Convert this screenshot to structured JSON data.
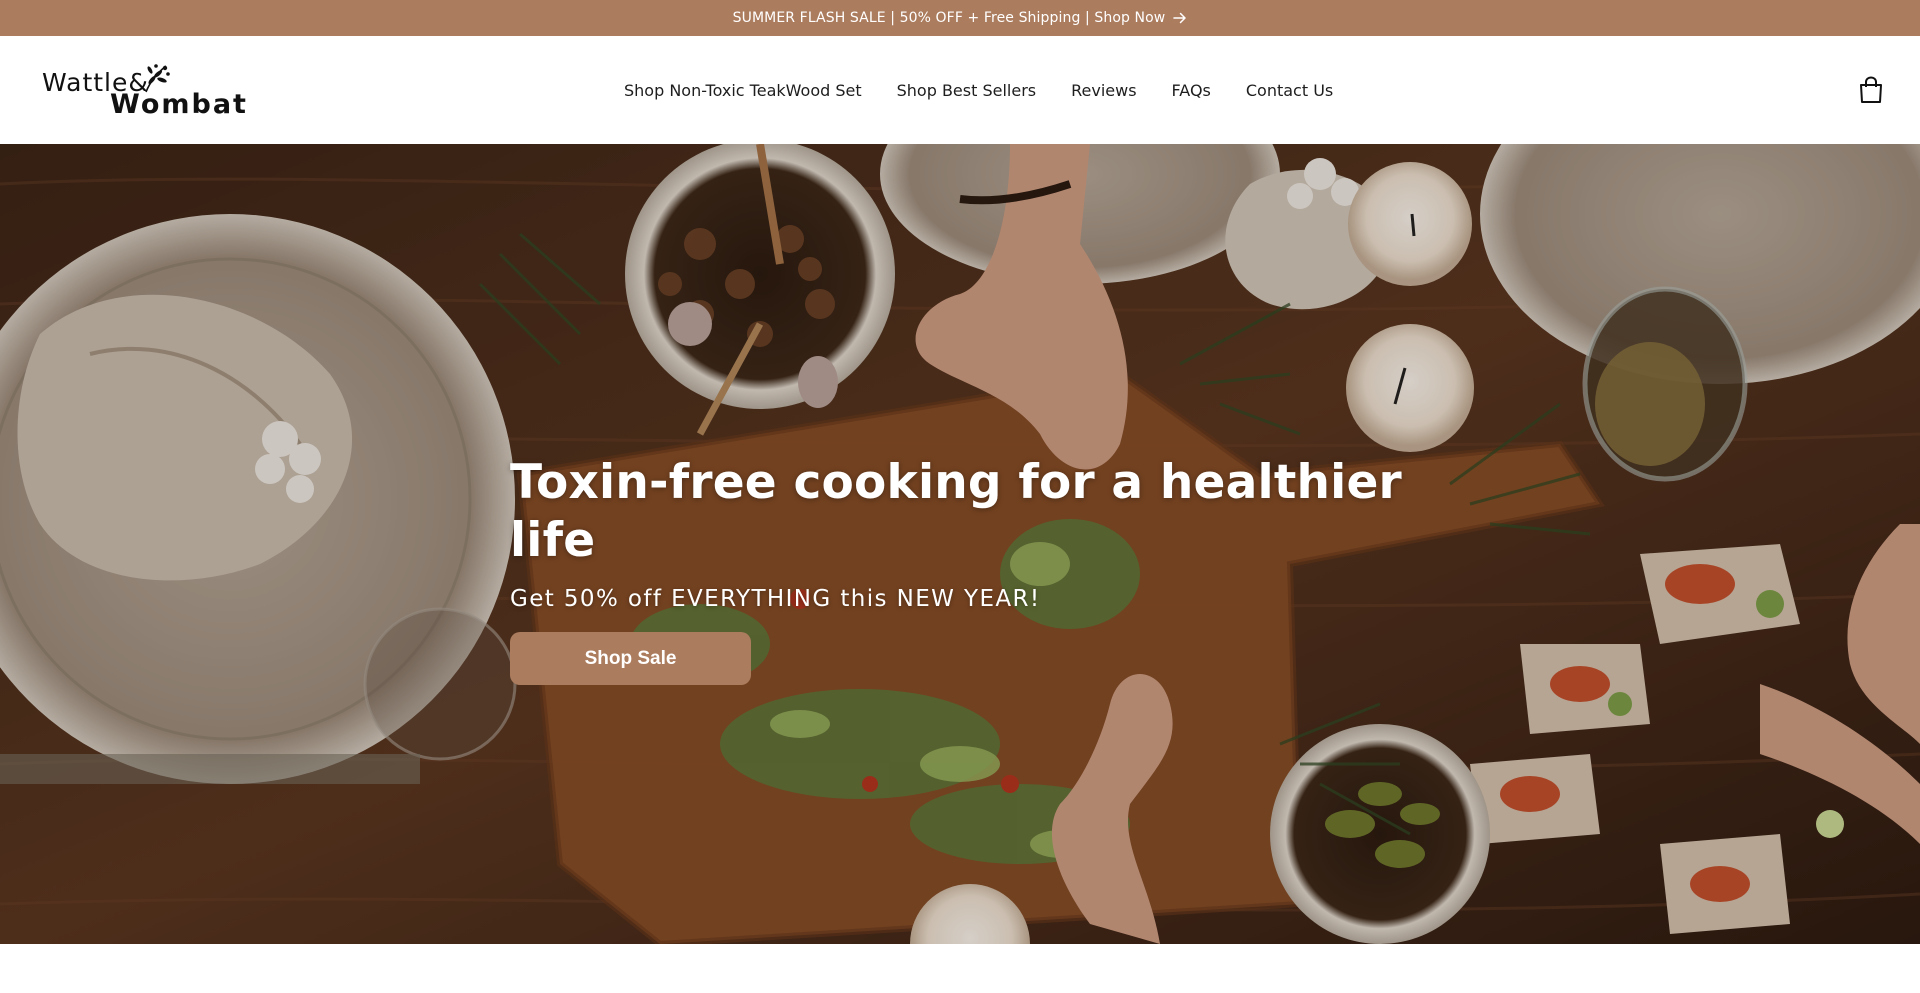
{
  "announcement": {
    "text": "SUMMER FLASH SALE | 50% OFF + Free Shipping | Shop Now",
    "arrow_icon": "arrow-right-icon"
  },
  "header": {
    "logo": {
      "line1": "Wattle&",
      "line2": "Wombat",
      "mark_icon": "wattle-sprig-icon"
    },
    "nav": [
      {
        "label": "Shop Non-Toxic TeakWood Set"
      },
      {
        "label": "Shop Best Sellers"
      },
      {
        "label": "Reviews"
      },
      {
        "label": "FAQs"
      },
      {
        "label": "Contact Us"
      }
    ],
    "cart_icon": "shopping-bag-icon"
  },
  "hero": {
    "title": "Toxin-free cooking for a healthier life",
    "subtitle": "Get 50% off EVERYTHING this NEW YEAR!",
    "button_label": "Shop Sale"
  },
  "colors": {
    "accent": "#ac7c5e",
    "text": "#1e1e1e",
    "background": "#ffffff"
  }
}
